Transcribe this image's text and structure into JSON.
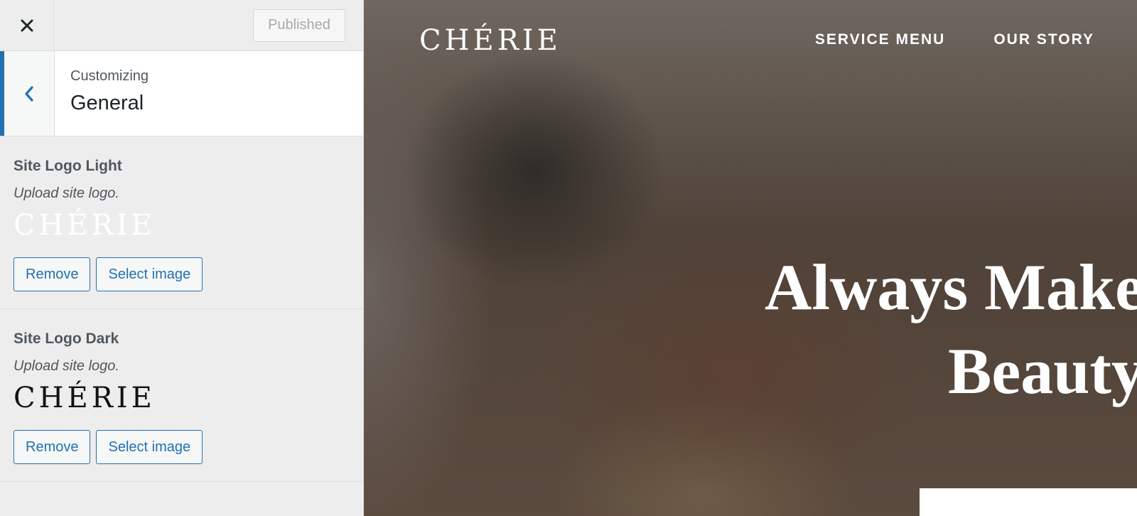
{
  "topbar": {
    "close_icon": "close-icon",
    "publish_label": "Published"
  },
  "section": {
    "back_icon": "chevron-left-icon",
    "subtitle": "Customizing",
    "title": "General"
  },
  "controls": [
    {
      "label": "Site Logo Light",
      "description": "Upload site logo.",
      "logo_text": "CHÉRIE",
      "remove_label": "Remove",
      "select_label": "Select image"
    },
    {
      "label": "Site Logo Dark",
      "description": "Upload site logo.",
      "logo_text": "CHÉRIE",
      "remove_label": "Remove",
      "select_label": "Select image"
    }
  ],
  "preview": {
    "site_logo": "CHÉRIE",
    "nav": [
      "SERVICE MENU",
      "OUR STORY"
    ],
    "hero_line1": "Always Make",
    "hero_line2": "Beauty"
  },
  "colors": {
    "accent": "#2271b1",
    "text": "#50575e"
  }
}
